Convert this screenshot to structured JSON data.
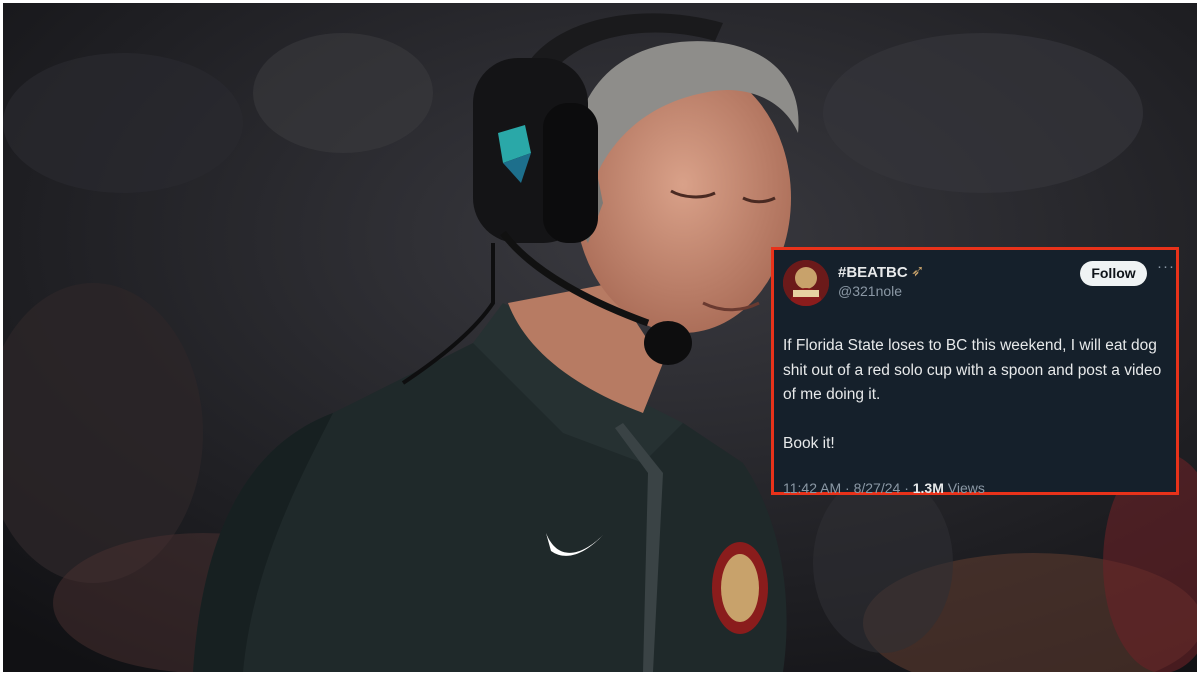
{
  "photo": {
    "description_icon": "coach-photo",
    "headset_brand": "RELIAQUEST",
    "colors": {
      "background": "#16161a",
      "jacket": "#202a2b",
      "garnet": "#8a1c1c",
      "gold": "#c8a26b"
    }
  },
  "tweet": {
    "display_name": "#BEATBC",
    "name_emoji": "spear-icon",
    "handle": "@321nole",
    "follow_label": "Follow",
    "more_icon": "more-icon",
    "body": [
      "If Florida State loses to BC this weekend, I will eat dog shit out of a red solo cup with a spoon and post a video of me doing it.",
      "Book it!"
    ],
    "time": "11:42 AM",
    "date": "8/27/24",
    "views_count": "1.3M",
    "views_label": "Views",
    "separator": "·",
    "colors": {
      "card": "#15202b",
      "border": "#e8321a",
      "text": "#e7e9ea",
      "muted": "#8b98a5",
      "follow_bg": "#eff3f4"
    }
  }
}
